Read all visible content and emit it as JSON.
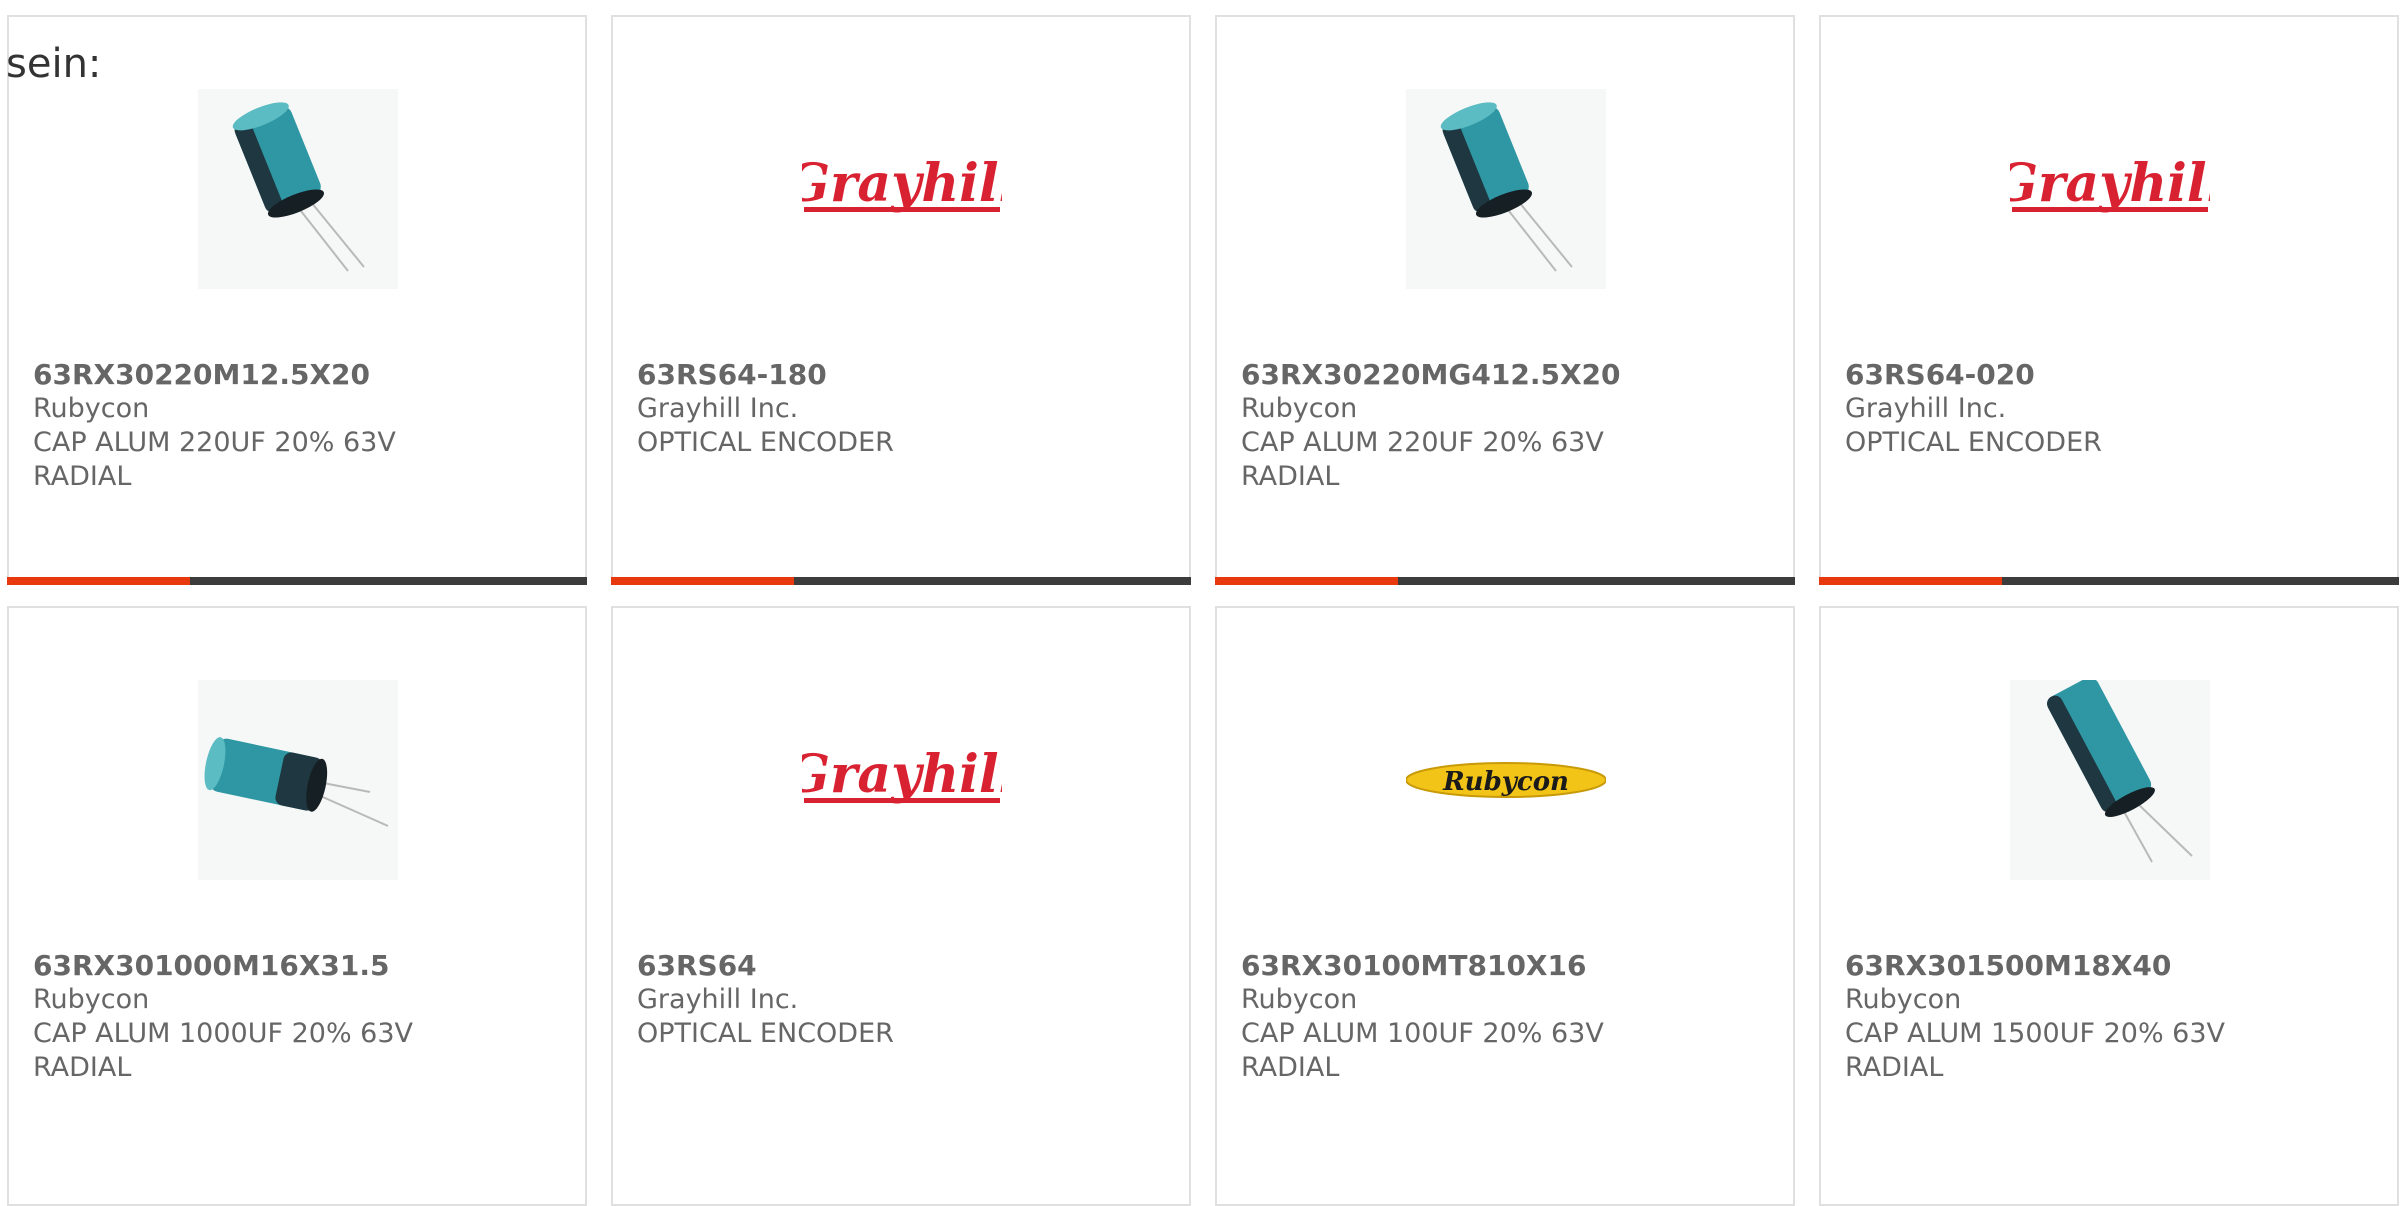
{
  "header_text": "sein:",
  "accent_color": "#e8380d",
  "products": [
    {
      "part": "63RX30220M12.5X20",
      "maker": "Rubycon",
      "desc1": "CAP ALUM 220UF 20% 63V",
      "desc2": "RADIAL",
      "image": "capacitor-upright",
      "logo": ""
    },
    {
      "part": "63RS64-180",
      "maker": "Grayhill Inc.",
      "desc1": "OPTICAL ENCODER",
      "desc2": "",
      "image": "grayhill-logo",
      "logo": "Grayhill"
    },
    {
      "part": "63RX30220MG412.5X20",
      "maker": "Rubycon",
      "desc1": "CAP ALUM 220UF 20% 63V",
      "desc2": "RADIAL",
      "image": "capacitor-upright",
      "logo": ""
    },
    {
      "part": "63RS64-020",
      "maker": "Grayhill Inc.",
      "desc1": "OPTICAL ENCODER",
      "desc2": "",
      "image": "grayhill-logo",
      "logo": "Grayhill"
    },
    {
      "part": "63RX301000M16X31.5",
      "maker": "Rubycon",
      "desc1": "CAP ALUM 1000UF 20% 63V",
      "desc2": "RADIAL",
      "image": "capacitor-lying",
      "logo": ""
    },
    {
      "part": "63RS64",
      "maker": "Grayhill Inc.",
      "desc1": "OPTICAL ENCODER",
      "desc2": "",
      "image": "grayhill-logo",
      "logo": "Grayhill"
    },
    {
      "part": "63RX30100MT810X16",
      "maker": "Rubycon",
      "desc1": "CAP ALUM 100UF 20% 63V",
      "desc2": "RADIAL",
      "image": "rubycon-logo",
      "logo": "Rubycon"
    },
    {
      "part": "63RX301500M18X40",
      "maker": "Rubycon",
      "desc1": "CAP ALUM 1500UF 20% 63V",
      "desc2": "RADIAL",
      "image": "capacitor-tilted",
      "logo": ""
    }
  ]
}
